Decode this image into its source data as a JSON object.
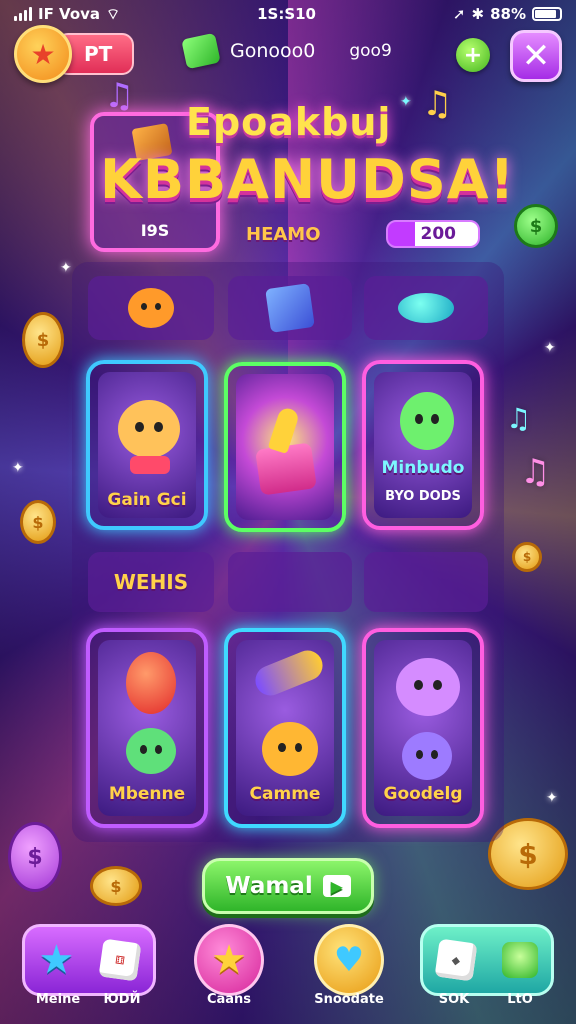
{
  "status_bar": {
    "carrier": "IF Vova",
    "time": "1S:S10",
    "battery": "88%"
  },
  "top_bar": {
    "level_label": "PT",
    "currency_value": "Gonooo0",
    "currency_secondary": "goo9",
    "plus_label": "+",
    "close_label": "✕"
  },
  "title": {
    "line1": "Epoakbuj",
    "line2": "KBBANUDSA!",
    "frame_label": "I9S",
    "hero_label": "HEAMO",
    "score": "200"
  },
  "grid": {
    "cards": [
      {
        "caption": "Gain Gci",
        "sub": "",
        "border": "#3fc9ff"
      },
      {
        "caption": "",
        "sub": "",
        "border": "#5cff64"
      },
      {
        "caption": "Minbudo",
        "sub": "BYO DODS",
        "border": "#ff5ee0"
      },
      {
        "caption": "Mbenne",
        "sub": "",
        "border": "#c05cff"
      },
      {
        "caption": "Camme",
        "sub": "",
        "border": "#3fd9ff"
      },
      {
        "caption": "Goodelg",
        "sub": "",
        "border": "#ff5ee0"
      }
    ],
    "middle_label": "WEHIS"
  },
  "play_button": {
    "label": "Wamal"
  },
  "bottom_nav": [
    {
      "label": "Meine"
    },
    {
      "label": "ЮDЙ"
    },
    {
      "label": "Caans"
    },
    {
      "label": "Snoodate"
    },
    {
      "label": "SOK"
    },
    {
      "label": "LtO"
    }
  ]
}
